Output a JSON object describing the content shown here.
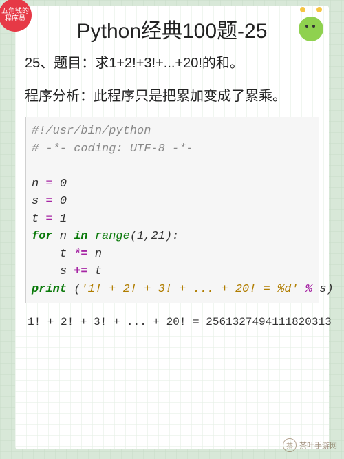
{
  "badge": {
    "line1": "五角钱的",
    "line2": "程序员"
  },
  "title": "Python经典100题-25",
  "problem": "25、题目：求1+2!+3!+...+20!的和。",
  "analysis": "程序分析：此程序只是把累加变成了累乘。",
  "code": {
    "shebang": "#!/usr/bin/python",
    "coding": "# -*- coding: UTF-8 -*-",
    "n_init": {
      "var": "n",
      "eq": " = ",
      "val": "0"
    },
    "s_init": {
      "var": "s",
      "eq": " = ",
      "val": "0"
    },
    "t_init": {
      "var": "t",
      "eq": " = ",
      "val": "1"
    },
    "for_kw": "for",
    "for_var": " n ",
    "in_kw": "in",
    "range_fn": " range",
    "range_args": "(1,21):",
    "t_update": {
      "indent": "    ",
      "var": "t",
      "op": " *= ",
      "rhs": "n"
    },
    "s_update": {
      "indent": "    ",
      "var": "s",
      "op": " += ",
      "rhs": "t"
    },
    "print_fn": "print",
    "print_open": " (",
    "print_str": "'1! + 2! + 3! + ... + 20! = %d'",
    "print_mod": " % ",
    "print_arg": "s)",
    "blank": " "
  },
  "output": "1! + 2! + 3! + ... + 20! = 2561327494111820313",
  "watermark": {
    "icon": "茶",
    "text": "茶叶手游网"
  }
}
